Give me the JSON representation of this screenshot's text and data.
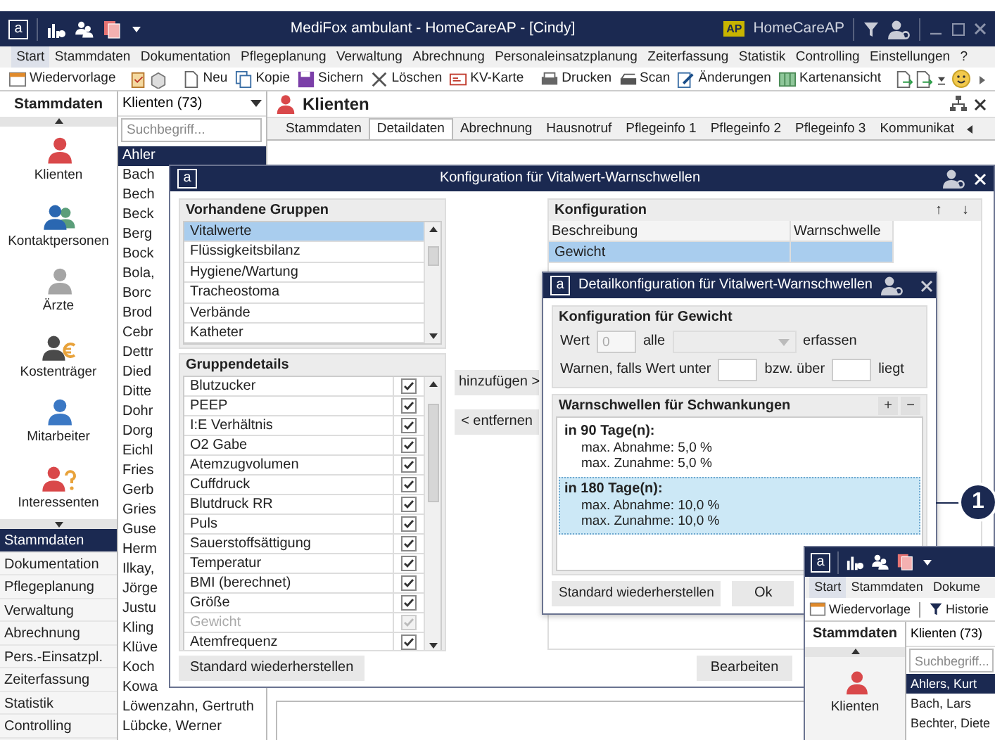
{
  "main_window": {
    "logo": "a",
    "title": "MediFox ambulant  -  HomeCareAP - [Cindy]",
    "badge": "AP",
    "account": "HomeCareAP"
  },
  "menu": [
    {
      "label": "Start",
      "selected": true
    },
    {
      "label": "Stammdaten",
      "selected": false
    },
    {
      "label": "Dokumentation",
      "selected": false
    },
    {
      "label": "Pflegeplanung",
      "selected": false
    },
    {
      "label": "Verwaltung",
      "selected": false
    },
    {
      "label": "Abrechnung",
      "selected": false
    },
    {
      "label": "Personaleinsatzplanung",
      "selected": false
    },
    {
      "label": "Zeiterfassung",
      "selected": false
    },
    {
      "label": "Statistik",
      "selected": false
    },
    {
      "label": "Controlling",
      "selected": false
    },
    {
      "label": "Einstellungen",
      "selected": false
    },
    {
      "label": "?",
      "selected": false
    }
  ],
  "toolbar": [
    {
      "kind": "button",
      "label": "Wiedervorlage"
    },
    {
      "kind": "separator"
    },
    {
      "kind": "icon"
    },
    {
      "kind": "icon"
    },
    {
      "kind": "separator"
    },
    {
      "kind": "button",
      "label": "Neu"
    },
    {
      "kind": "button",
      "label": "Kopie"
    },
    {
      "kind": "button",
      "label": "Sichern"
    },
    {
      "kind": "button",
      "label": "Löschen"
    },
    {
      "kind": "button",
      "label": "KV-Karte"
    },
    {
      "kind": "separator"
    },
    {
      "kind": "button",
      "label": "Drucken"
    },
    {
      "kind": "button",
      "label": "Scan"
    },
    {
      "kind": "button",
      "label": "Änderungen"
    },
    {
      "kind": "button",
      "label": "Kartenansicht"
    },
    {
      "kind": "separator"
    },
    {
      "kind": "icon"
    },
    {
      "kind": "icon"
    },
    {
      "kind": "dropdown"
    },
    {
      "kind": "spacer"
    },
    {
      "kind": "flyout"
    },
    {
      "kind": "flyout"
    }
  ],
  "sidebar": {
    "title": "Stammdaten",
    "modules": [
      {
        "label": "Klienten"
      },
      {
        "label": "Kontaktpersonen"
      },
      {
        "label": "Ärzte"
      },
      {
        "label": "Kostenträger"
      },
      {
        "label": "Mitarbeiter"
      },
      {
        "label": "Interessenten"
      }
    ],
    "sections": [
      {
        "label": "Stammdaten",
        "selected": true
      },
      {
        "label": "Dokumentation",
        "selected": false
      },
      {
        "label": "Pflegeplanung",
        "selected": false
      },
      {
        "label": "Verwaltung",
        "selected": false
      },
      {
        "label": "Abrechnung",
        "selected": false
      },
      {
        "label": "Pers.-Einsatzpl.",
        "selected": false
      },
      {
        "label": "Zeiterfassung",
        "selected": false
      },
      {
        "label": "Statistik",
        "selected": false
      },
      {
        "label": "Controlling",
        "selected": false
      }
    ]
  },
  "client_list": {
    "filter": "Klienten (73)",
    "search_placeholder": "Suchbegriff...",
    "rows": [
      {
        "name": "Ahler",
        "selected": true
      },
      {
        "name": "Bach",
        "selected": false
      },
      {
        "name": "Bech",
        "selected": false
      },
      {
        "name": "Beck",
        "selected": false
      },
      {
        "name": "Berg",
        "selected": false
      },
      {
        "name": "Bock",
        "selected": false
      },
      {
        "name": "Bola,",
        "selected": false
      },
      {
        "name": "Borc",
        "selected": false
      },
      {
        "name": "Brod",
        "selected": false
      },
      {
        "name": "Cebr",
        "selected": false
      },
      {
        "name": "Dettr",
        "selected": false
      },
      {
        "name": "Died",
        "selected": false
      },
      {
        "name": "Ditte",
        "selected": false
      },
      {
        "name": "Dohr",
        "selected": false
      },
      {
        "name": "Dorg",
        "selected": false
      },
      {
        "name": "Eichl",
        "selected": false
      },
      {
        "name": "Fries",
        "selected": false
      },
      {
        "name": "Gerb",
        "selected": false
      },
      {
        "name": "Gries",
        "selected": false
      },
      {
        "name": "Guse",
        "selected": false
      },
      {
        "name": "Herm",
        "selected": false
      },
      {
        "name": "Ilkay,",
        "selected": false
      },
      {
        "name": "Jörge",
        "selected": false
      },
      {
        "name": "Justu",
        "selected": false
      },
      {
        "name": "Kling",
        "selected": false
      },
      {
        "name": "Klüve",
        "selected": false
      },
      {
        "name": "Koch",
        "selected": false
      },
      {
        "name": "Kowa",
        "selected": false
      },
      {
        "name": "Löwenzahn, Gertruth",
        "selected": false
      },
      {
        "name": "Lübcke, Werner",
        "selected": false
      }
    ]
  },
  "record": {
    "title": "Klienten",
    "tabs": [
      {
        "label": "Stammdaten",
        "selected": false
      },
      {
        "label": "Detaildaten",
        "selected": true
      },
      {
        "label": "Abrechnung",
        "selected": false
      },
      {
        "label": "Hausnotruf",
        "selected": false
      },
      {
        "label": "Pflegeinfo 1",
        "selected": false
      },
      {
        "label": "Pflegeinfo 2",
        "selected": false
      },
      {
        "label": "Pflegeinfo 3",
        "selected": false
      },
      {
        "label": "Kommunikat",
        "selected": false
      }
    ]
  },
  "config_dialog": {
    "logo": "a",
    "title": "Konfiguration für Vitalwert-Warnschwellen",
    "groups_title": "Vorhandene Gruppen",
    "groups": [
      {
        "label": "Vitalwerte",
        "selected": true
      },
      {
        "label": "Flüssigkeitsbilanz",
        "selected": false
      },
      {
        "label": "Hygiene/Wartung",
        "selected": false
      },
      {
        "label": "Tracheostoma",
        "selected": false
      },
      {
        "label": "Verbände",
        "selected": false
      },
      {
        "label": "Katheter",
        "selected": false
      }
    ],
    "details_title": "Gruppendetails",
    "details": [
      {
        "label": "Blutzucker",
        "checked": true,
        "disabled": false
      },
      {
        "label": "PEEP",
        "checked": true,
        "disabled": false
      },
      {
        "label": "I:E Verhältnis",
        "checked": true,
        "disabled": false
      },
      {
        "label": "O2  Gabe",
        "checked": true,
        "disabled": false
      },
      {
        "label": "Atemzugvolumen",
        "checked": true,
        "disabled": false
      },
      {
        "label": "Cuffdruck",
        "checked": true,
        "disabled": false
      },
      {
        "label": "Blutdruck RR",
        "checked": true,
        "disabled": false
      },
      {
        "label": "Puls",
        "checked": true,
        "disabled": false
      },
      {
        "label": "Sauerstoffsättigung",
        "checked": true,
        "disabled": false
      },
      {
        "label": "Temperatur",
        "checked": true,
        "disabled": false
      },
      {
        "label": "BMI (berechnet)",
        "checked": true,
        "disabled": false
      },
      {
        "label": "Größe",
        "checked": true,
        "disabled": false
      },
      {
        "label": "Gewicht",
        "checked": true,
        "disabled": true
      },
      {
        "label": "Atemfrequenz",
        "checked": true,
        "disabled": false
      }
    ],
    "add_button": "hinzufügen >",
    "remove_button": "< entfernen",
    "restore_button": "Standard wiederherstellen",
    "config_title": "Konfiguration",
    "up": "↑",
    "down": "↓",
    "columns": [
      "Beschreibung",
      "Warnschwelle"
    ],
    "rows": [
      {
        "description": "Gewicht",
        "selected": true
      }
    ],
    "edit_button": "Bearbeiten"
  },
  "detail_dialog": {
    "logo": "a",
    "title": "Detailkonfiguration für Vitalwert-Warnschwellen",
    "section_title": "Konfiguration für Gewicht",
    "value_label": "Wert",
    "value": "0",
    "value_disabled": true,
    "every_label": "alle",
    "interval_disabled": true,
    "record_label": "erfassen",
    "warn_label": "Warnen, falls Wert unter",
    "or_label": "bzw. über",
    "end_label": "liegt",
    "thresholds_title": "Warnschwellen für Schwankungen",
    "add": "+",
    "remove": "−",
    "thresholds": [
      {
        "title": "in 90 Tage(n):",
        "lines": [
          "max. Abnahme: 5,0 %",
          "max. Zunahme: 5,0 %"
        ],
        "selected": false
      },
      {
        "title": "in 180 Tage(n):",
        "lines": [
          "max. Abnahme: 10,0 %",
          "max. Zunahme: 10,0 %"
        ],
        "selected": true
      }
    ],
    "restore_button": "Standard wiederherstellen",
    "ok_button": "Ok"
  },
  "inset_window": {
    "logo": "a",
    "menu": [
      {
        "label": "Start",
        "selected": true
      },
      {
        "label": "Stammdaten",
        "selected": false
      },
      {
        "label": "Dokume",
        "selected": false
      }
    ],
    "toolbar": [
      "Wiedervorlage",
      "Historie"
    ],
    "sidebar_title": "Stammdaten",
    "module": "Klienten",
    "filter": "Klienten (73)",
    "search_placeholder": "Suchbegriff...",
    "rows": [
      {
        "name": "Ahlers, Kurt",
        "selected": true
      },
      {
        "name": "Bach, Lars",
        "selected": false
      },
      {
        "name": "Bechter, Diete",
        "selected": false
      }
    ]
  },
  "callout": {
    "label": "1"
  }
}
